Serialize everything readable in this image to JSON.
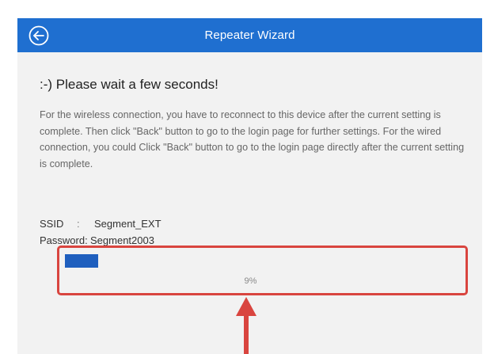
{
  "header": {
    "title": "Repeater Wizard",
    "back_icon": "circle-arrow-left-icon",
    "color": "#1f6fd0"
  },
  "main": {
    "wait_title": ":-) Please wait a few seconds!",
    "description": "For the wireless connection, you have to reconnect to this device after the current setting is complete. Then click \"Back\" button to go to the login page for further settings. For the wired connection, you could Click \"Back\" button to go to the login page directly after the current setting is complete.",
    "ssid_label": "SSID",
    "ssid_sep": ":",
    "ssid_value": "Segment_EXT",
    "password_label": "Password:",
    "password_value": "Segment2003",
    "progress_fraction": 0.09,
    "progress_text": "9%",
    "progress_color": "#1f5fbe"
  },
  "annotation": {
    "highlight_color": "#d9453f",
    "arrow_icon": "up-arrow-icon"
  }
}
